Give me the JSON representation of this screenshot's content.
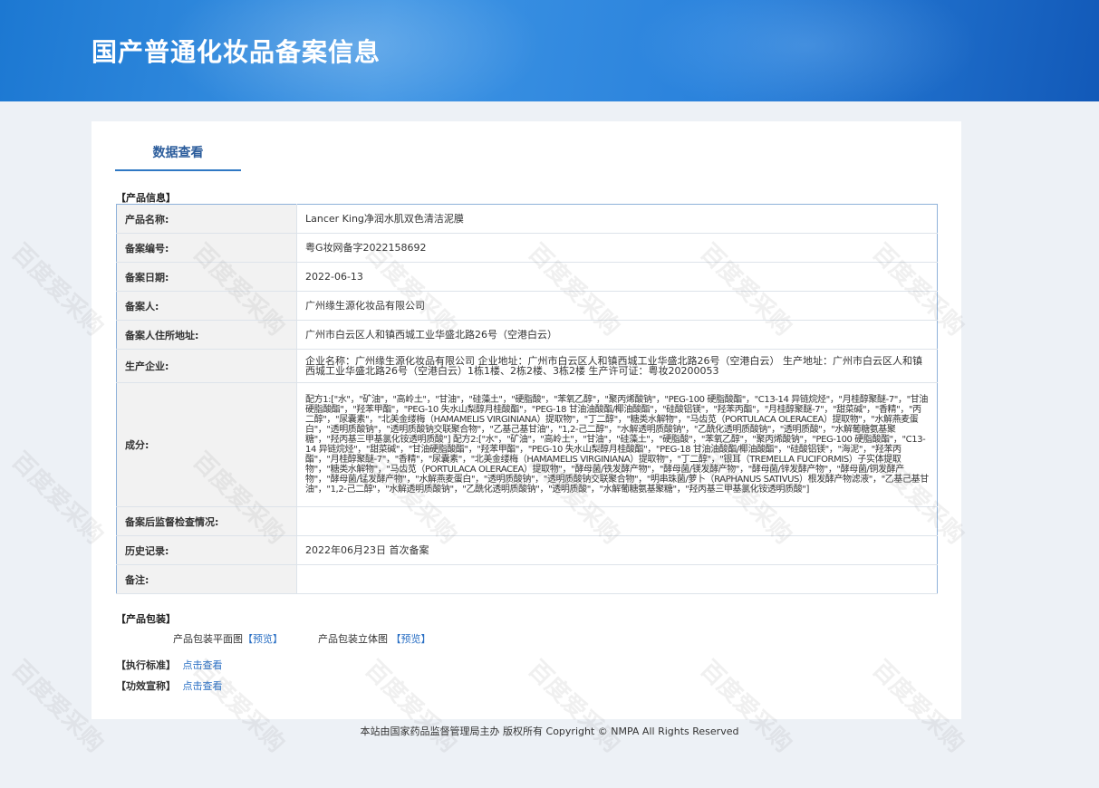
{
  "header": {
    "title": "国产普通化妆品备案信息"
  },
  "tab": {
    "label": "数据查看"
  },
  "product_info": {
    "section_title": "【产品信息】",
    "rows": [
      {
        "label": "产品名称:",
        "value": "Lancer King净润水肌双色清洁泥膜"
      },
      {
        "label": "备案编号:",
        "value": "粤G妆网备字2022158692"
      },
      {
        "label": "备案日期:",
        "value": "2022-06-13"
      },
      {
        "label": "备案人:",
        "value": "广州缘生源化妆品有限公司"
      },
      {
        "label": "备案人住所地址:",
        "value": "广州市白云区人和镇西城工业华盛北路26号（空港白云）"
      },
      {
        "label": "生产企业:",
        "value": "企业名称：广州缘生源化妆品有限公司 企业地址：广州市白云区人和镇西城工业华盛北路26号（空港白云） 生产地址：广州市白云区人和镇西城工业华盛北路26号（空港白云）1栋1楼、2栋2楼、3栋2楼 生产许可证：粤妆20200053"
      },
      {
        "label": "成分:",
        "value": "配方1:[\"水\"，\"矿油\"，\"高岭土\"，\"甘油\"，\"硅藻土\"，\"硬脂酸\"，\"苯氧乙醇\"，\"聚丙烯酸钠\"，\"PEG-100 硬脂酸酯\"，\"C13-14 异链烷烃\"，\"月桂醇聚醚-7\"，\"甘油硬脂酸酯\"，\"羟苯甲酯\"，\"PEG-10 失水山梨醇月桂酸酯\"，\"PEG-18 甘油油酸酯/椰油酸酯\"，\"硅酸铝镁\"，\"羟苯丙酯\"，\"月桂醇聚醚-7\"，\"甜菜碱\"，\"香精\"，\"丙二醇\"，\"尿囊素\"，\"北美金缕梅（HAMAMELIS VIRGINIANA）提取物\"，\"丁二醇\"，\"糖类水解物\"，\"马齿苋（PORTULACA OLERACEA）提取物\"，\"水解燕麦蛋白\"，\"透明质酸钠\"，\"透明质酸钠交联聚合物\"，\"乙基己基甘油\"，\"1,2-己二醇\"，\"水解透明质酸钠\"，\"乙酰化透明质酸钠\"，\"透明质酸\"，\"水解葡糖氨基聚糖\"，\"羟丙基三甲基氯化铵透明质酸\"] 配方2:[\"水\"，\"矿油\"，\"高岭土\"，\"甘油\"，\"硅藻土\"，\"硬脂酸\"，\"苯氧乙醇\"，\"聚丙烯酸钠\"，\"PEG-100 硬脂酸酯\"，\"C13-14 异链烷烃\"，\"甜菜碱\"，\"甘油硬脂酸酯\"，\"羟苯甲酯\"，\"PEG-10 失水山梨醇月桂酸酯\"，\"PEG-18 甘油油酸酯/椰油酸酯\"，\"硅酸铝镁\"，\"海泥\"，\"羟苯丙酯\"，\"月桂醇聚醚-7\"，\"香精\"，\"尿囊素\"，\"北美金缕梅（HAMAMELIS VIRGINIANA）提取物\"，\"丁二醇\"，\"银耳（TREMELLA FUCIFORMIS）子实体提取物\"，\"糖类水解物\"，\"马齿苋（PORTULACA OLERACEA）提取物\"，\"酵母菌/铁发酵产物\"，\"酵母菌/镁发酵产物\"，\"酵母菌/锌发酵产物\"，\"酵母菌/铜发酵产物\"，\"酵母菌/锰发酵产物\"，\"水解燕麦蛋白\"，\"透明质酸钠\"，\"透明质酸钠交联聚合物\"，\"明串珠菌/萝卜（RAPHANUS SATIVUS）根发酵产物滤液\"，\"乙基己基甘油\"，\"1,2-己二醇\"，\"水解透明质酸钠\"，\"乙酰化透明质酸钠\"，\"透明质酸\"，\"水解葡糖氨基聚糖\"，\"羟丙基三甲基氯化铵透明质酸\"]"
      },
      {
        "label": "备案后监督检查情况:",
        "value": ""
      },
      {
        "label": "历史记录:",
        "value": "2022年06月23日 首次备案"
      },
      {
        "label": "备注:",
        "value": ""
      }
    ]
  },
  "packaging": {
    "section_title": "【产品包装】",
    "flat_label": "产品包装平面图",
    "flat_link": "【预览】",
    "solid_label": "产品包装立体图",
    "solid_link": "【预览】"
  },
  "standard": {
    "label": "【执行标准】",
    "link": "点击查看"
  },
  "efficacy": {
    "label": "【功效宣称】",
    "link": "点击查看"
  },
  "footer": {
    "text": "本站由国家药品监督管理局主办 版权所有 Copyright © NMPA All Rights Reserved"
  },
  "watermark": {
    "text": "百度爱采购"
  }
}
